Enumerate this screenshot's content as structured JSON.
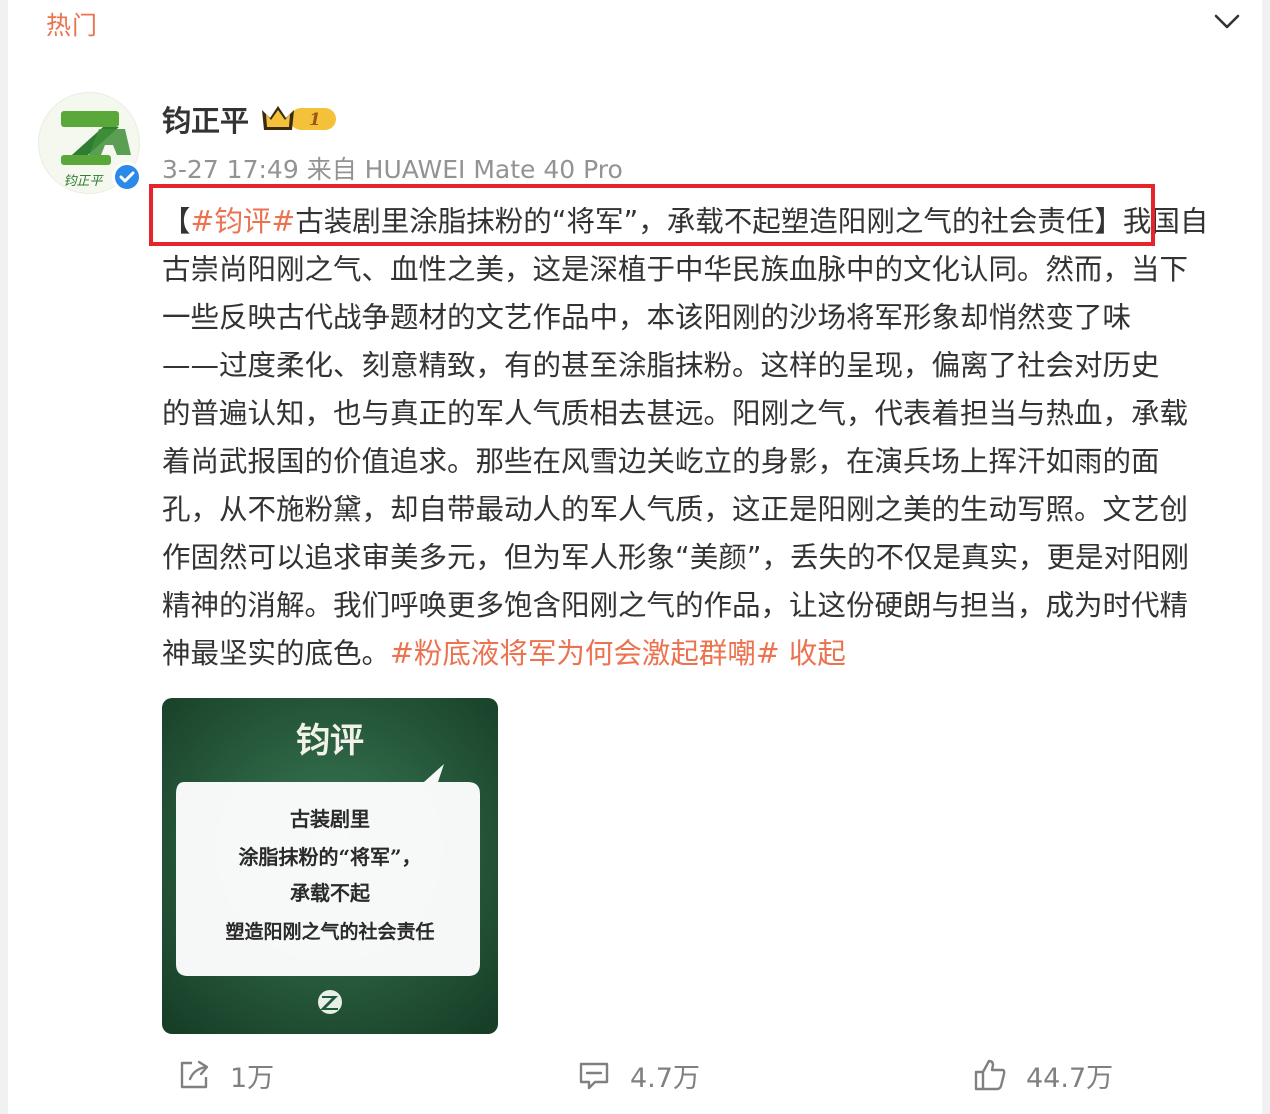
{
  "header": {
    "hot_label": "热门",
    "collapse_icon": "chevron-down-icon"
  },
  "post": {
    "author": {
      "name": "钧正平",
      "avatar_text": "钧正平",
      "vip_level": "1"
    },
    "meta": {
      "time": "3-27 17:49",
      "source_prefix": "来自",
      "device": "HUAWEI Mate 40 Pro"
    },
    "body_lines": [
      {
        "parts": [
          {
            "t": "【",
            "tag": false
          },
          {
            "t": "#钧评#",
            "tag": true
          },
          {
            "t": "古装剧里涂脂抹粉的“将军”，承载不起塑造阳刚之气的社会责任】我国自",
            "tag": false
          }
        ]
      },
      {
        "parts": [
          {
            "t": "古崇尚阳刚之气、血性之美，这是深植于中华民族血脉中的文化认同。然而，当下",
            "tag": false
          }
        ]
      },
      {
        "parts": [
          {
            "t": "一些反映古代战争题材的文艺作品中，本该阳刚的沙场将军形象却悄然变了味",
            "tag": false
          }
        ]
      },
      {
        "parts": [
          {
            "t": "——过度柔化、刻意精致，有的甚至涂脂抹粉。这样的呈现，偏离了社会对历史",
            "tag": false
          }
        ]
      },
      {
        "parts": [
          {
            "t": "的普遍认知，也与真正的军人气质相去甚远。阳刚之气，代表着担当与热血，承载",
            "tag": false
          }
        ]
      },
      {
        "parts": [
          {
            "t": "着尚武报国的价值追求。那些在风雪边关屹立的身影，在演兵场上挥汗如雨的面",
            "tag": false
          }
        ]
      },
      {
        "parts": [
          {
            "t": "孔，从不施粉黛，却自带最动人的军人气质，这正是阳刚之美的生动写照。文艺创",
            "tag": false
          }
        ]
      },
      {
        "parts": [
          {
            "t": "作固然可以追求审美多元，但为军人形象“美颜”，丢失的不仅是真实，更是对阳刚",
            "tag": false
          }
        ]
      },
      {
        "parts": [
          {
            "t": "精神的消解。我们呼唤更多饱含阳刚之气的作品，让这份硬朗与担当，成为时代精",
            "tag": false
          }
        ]
      },
      {
        "parts": [
          {
            "t": "神最坚实的底色。",
            "tag": false
          },
          {
            "t": "#粉底液将军为何会激起群嘲#",
            "tag": true
          },
          {
            "t": " 收起",
            "tag": true
          }
        ]
      }
    ],
    "image": {
      "title": "钧评",
      "lines": [
        "古装剧里",
        "涂脂抹粉的“将军”，",
        "承载不起",
        "塑造阳刚之气的社会责任"
      ],
      "bg_color": "#1f5a3a"
    },
    "actions": {
      "repost": {
        "icon": "share-icon",
        "count": "1万"
      },
      "comment": {
        "icon": "comment-icon",
        "count": "4.7万"
      },
      "like": {
        "icon": "thumbs-up-icon",
        "count": "44.7万"
      }
    }
  },
  "colors": {
    "accent": "#eb7350",
    "highlight_border": "#e5242b",
    "verified": "#2b8ae8"
  }
}
